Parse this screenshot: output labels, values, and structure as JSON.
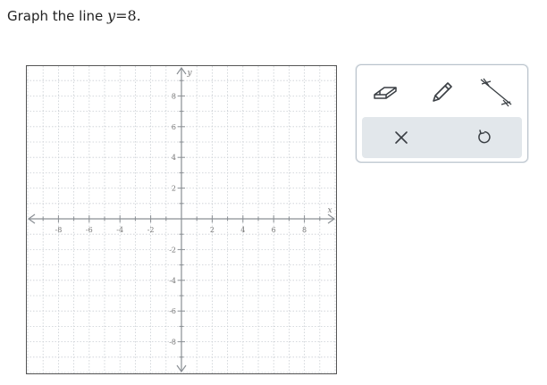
{
  "prompt": {
    "text": "Graph the line",
    "var": "y",
    "op": "=",
    "value": "8",
    "end": "."
  },
  "graph": {
    "x_axis_label": "x",
    "y_axis_label": "y",
    "x_range": [
      -9.5,
      9.5
    ],
    "y_range": [
      -9.5,
      9.5
    ],
    "major_step": 2,
    "minor_step": 1,
    "x_tick_labels": [
      "-8",
      "-6",
      "-4",
      "-2",
      "2",
      "4",
      "6",
      "8"
    ],
    "y_tick_labels": [
      "8",
      "6",
      "4",
      "2",
      "-2",
      "-4",
      "-6",
      "-8"
    ],
    "colors": {
      "grid": "#c9ced3",
      "axis": "#8a8f94",
      "border": "#555555"
    }
  },
  "toolbox": {
    "tools": [
      {
        "id": "eraser",
        "icon": "eraser-icon"
      },
      {
        "id": "pencil",
        "icon": "pencil-icon"
      },
      {
        "id": "line",
        "icon": "line-tool-icon"
      }
    ],
    "actions": [
      {
        "id": "clear",
        "icon": "close-icon"
      },
      {
        "id": "undo",
        "icon": "undo-icon"
      }
    ],
    "colors": {
      "icon": "#3a3f44",
      "action_bg": "#e2e7eb",
      "border": "#b9c2cb"
    }
  }
}
